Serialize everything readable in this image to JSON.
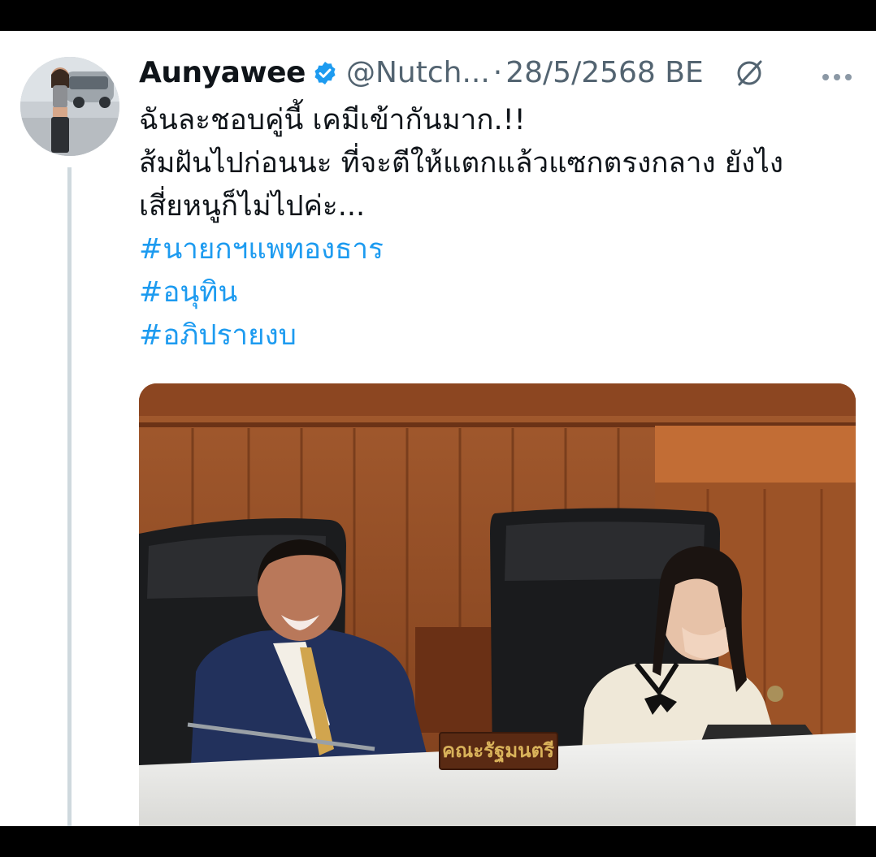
{
  "tweet": {
    "author": {
      "display_name": "Aunyawee",
      "handle": "@Nutch...",
      "verified": true,
      "avatar_icon": "profile-photo"
    },
    "separator": "·",
    "date": "28/5/2568 BE",
    "edited_icon": "edited-icon",
    "more_icon": "more-icon",
    "text_lines": [
      "ฉันละชอบคู่นี้ เคมีเข้ากันมาก.!!",
      "ส้มฝันไปก่อนนะ ที่จะตีให้แตกแล้วแซกตรงกลาง ยังไง",
      "เสี่ยหนูก็ไม่ไปค่ะ..."
    ],
    "hashtags": [
      "#นายกฯแพทองธาร",
      "#อนุทิน",
      "#อภิปรายงบ"
    ],
    "media": {
      "nameplate_text": "คณะรัฐมนตรี"
    },
    "colors": {
      "link": "#1d9bf0",
      "verified": "#1d9bf0",
      "text": "#0f1419",
      "secondary": "#536471"
    }
  }
}
